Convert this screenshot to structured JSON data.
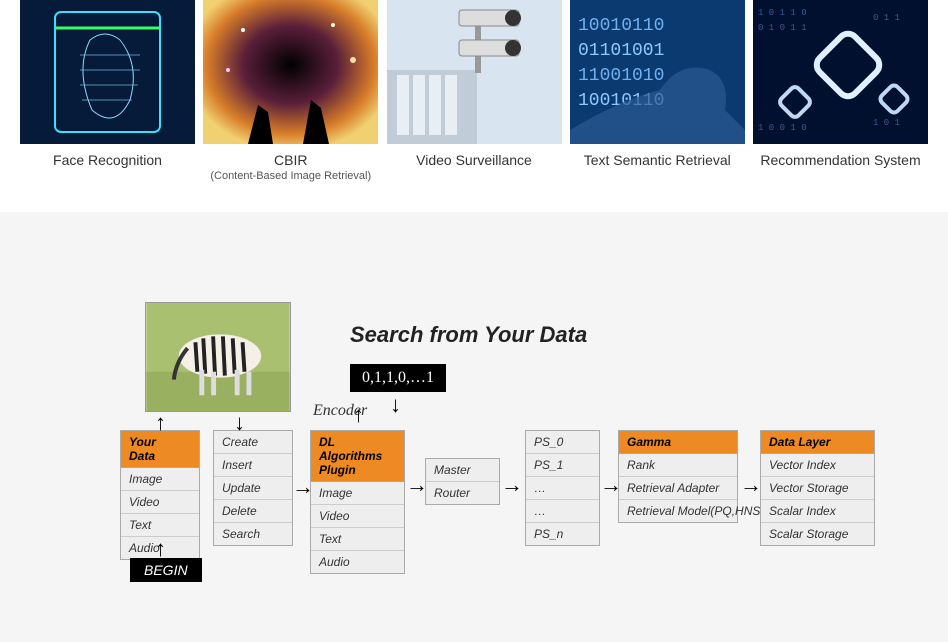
{
  "apps": [
    {
      "label": "Face Recognition",
      "sublabel": ""
    },
    {
      "label": "CBIR",
      "sublabel": "(Content-Based Image Retrieval)"
    },
    {
      "label": "Video Surveillance",
      "sublabel": ""
    },
    {
      "label": "Text Semantic Retrieval",
      "sublabel": ""
    },
    {
      "label": "Recommendation System",
      "sublabel": ""
    }
  ],
  "diagram": {
    "title": "Search from Your Data",
    "vector": "0,1,1,0,…1",
    "encoder_label": "Encoder",
    "begin": "BEGIN",
    "yourdata": {
      "header": "Your\nData",
      "rows": [
        "Image",
        "Video",
        "Text",
        "Audio"
      ]
    },
    "ops": {
      "header": "",
      "rows": [
        "Create",
        "Insert",
        "Update",
        "Delete",
        "Search"
      ]
    },
    "dlalg": {
      "header": "DL Algorithms\nPlugin",
      "rows": [
        "Image",
        "Video",
        "Text",
        "Audio"
      ]
    },
    "master": {
      "header": "",
      "rows": [
        "Master",
        "Router"
      ]
    },
    "ps": {
      "header": "",
      "rows": [
        "PS_0",
        "PS_1",
        "…",
        "…",
        "PS_n"
      ]
    },
    "gamma": {
      "header": "Gamma",
      "rows": [
        "Rank",
        "Retrieval Adapter",
        "Retrieval Model(PQ,HNSW)"
      ]
    },
    "datalayer": {
      "header": "Data Layer",
      "rows": [
        "Vector Index",
        "Vector Storage",
        "Scalar Index",
        "Scalar Storage"
      ]
    }
  }
}
